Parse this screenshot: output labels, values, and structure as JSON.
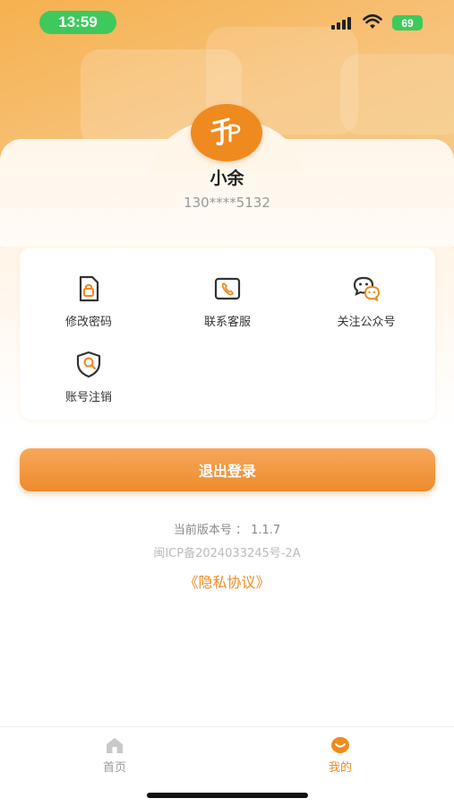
{
  "status_bar": {
    "time": "13:59",
    "battery": "69"
  },
  "profile": {
    "name": "小余",
    "phone": "130****5132"
  },
  "menu": {
    "items": [
      {
        "label": "修改密码",
        "icon": "lock-document-icon"
      },
      {
        "label": "联系客服",
        "icon": "phone-icon"
      },
      {
        "label": "关注公众号",
        "icon": "wechat-icon"
      },
      {
        "label": "账号注销",
        "icon": "shield-user-icon"
      }
    ]
  },
  "logout": {
    "label": "退出登录"
  },
  "footer": {
    "version": "当前版本号 ： 1.1.7",
    "icp": "闽ICP备2024033245号-2A",
    "privacy": "《隐私协议》"
  },
  "tabs": [
    {
      "label": "首页",
      "icon": "home-icon",
      "active": false
    },
    {
      "label": "我的",
      "icon": "profile-icon",
      "active": true
    }
  ],
  "colors": {
    "accent": "#ef8a1f",
    "status_green": "#3ec95c"
  }
}
